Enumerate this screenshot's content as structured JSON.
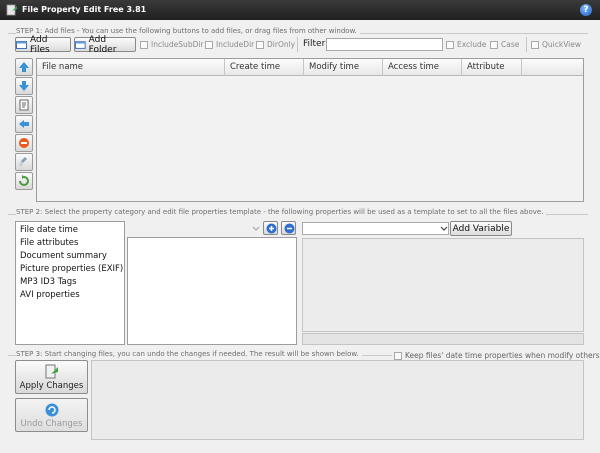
{
  "window": {
    "title": "File Property Edit Free 3.81",
    "help_label": "?"
  },
  "step1": {
    "label": "STEP 1: Add files - You can use the following buttons to add files, or drag files from other window.",
    "add_files": "Add Files",
    "add_folder": "Add Folder",
    "include_subdir": "IncludeSubDir",
    "include_dir": "IncludeDir",
    "dir_only": "DirOnly",
    "filter_label": "Filter:",
    "filter_value": "",
    "exclude": "Exclude",
    "case": "Case",
    "quickview": "QuickView"
  },
  "grid": {
    "columns": [
      "File name",
      "Create time",
      "Modify time",
      "Access time",
      "Attribute"
    ]
  },
  "step2": {
    "label": "STEP 2: Select the property category and edit file properties template - the following properties will be used as a template to set to all the files above.",
    "categories": [
      "File date time",
      "File attributes",
      "Document summary",
      "Picture properties (EXIF)",
      "MP3 ID3 Tags",
      "AVI properties"
    ],
    "variable_value": "",
    "add_variable": "Add Variable"
  },
  "step3": {
    "label": "STEP 3: Start changing files, you can undo the changes if needed. The result will be shown below.",
    "keep_times": "Keep files' date time properties when modify others",
    "apply": "Apply Changes",
    "undo": "Undo Changes"
  },
  "colors": {
    "titlebar": "#2a2a2a",
    "accent": "#1f5fc4",
    "window_bg": "#f0f0f0"
  }
}
